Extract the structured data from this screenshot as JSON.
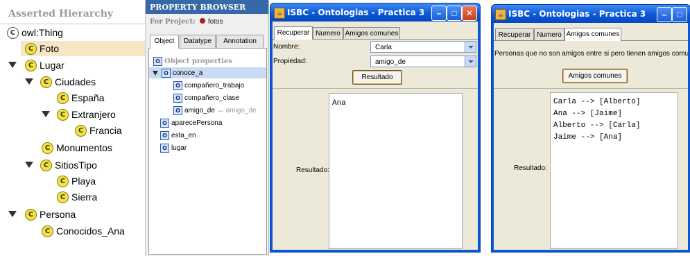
{
  "hierarchy": {
    "title": "Asserted Hierarchy",
    "icon_letter": "C",
    "nodes": [
      {
        "label": "owl:Thing"
      },
      {
        "label": "Foto"
      },
      {
        "label": "Lugar"
      },
      {
        "label": "Ciudades"
      },
      {
        "label": "España"
      },
      {
        "label": "Extranjero"
      },
      {
        "label": "Francia"
      },
      {
        "label": "Monumentos"
      },
      {
        "label": "SitiosTipo"
      },
      {
        "label": "Playa"
      },
      {
        "label": "Sierra"
      },
      {
        "label": "Persona"
      },
      {
        "label": "Conocidos_Ana"
      }
    ]
  },
  "property_browser": {
    "title": "PROPERTY BROWSER",
    "for_project_label": "For Project:",
    "project_name": "fotos",
    "tabs": [
      "Object",
      "Datatype",
      "Annotation"
    ],
    "section_header": "Object properties",
    "icon_letter": "O",
    "items": [
      {
        "label": "conoce_a"
      },
      {
        "label": "compañero_trabajo"
      },
      {
        "label": "compañero_clase"
      },
      {
        "label": "amigo_de",
        "inverse": "↔ amigo_de"
      },
      {
        "label": "aparecePersona"
      },
      {
        "label": "esta_en"
      },
      {
        "label": "lugar"
      }
    ]
  },
  "window1": {
    "title": "ISBC - Ontologias - Practica 3",
    "tabs": [
      "Recuperar",
      "Numero",
      "Amigos comunes"
    ],
    "nombre_label": "Nombre:",
    "nombre_value": "Carla",
    "propiedad_label": "Propiedad:",
    "propiedad_value": "amigo_de",
    "button": "Resultado",
    "resultado_label": "Resultado:",
    "output": "Ana"
  },
  "window2": {
    "title": "ISBC - Ontologias - Practica 3",
    "tabs": [
      "Recuperar",
      "Numero",
      "Amigos comunes"
    ],
    "description": "Personas que no son amigos entre si pero tienen amigos comunes",
    "button": "Amigos comunes",
    "resultado_label": "Resultado:",
    "output_lines": [
      "Carla --> [Alberto]",
      "Ana --> [Jaime]",
      "Alberto --> [Carla]",
      "Jaime --> [Ana]"
    ]
  },
  "colors": {
    "selection_class": "#f6e6c6",
    "selection_property": "#c8dbf2",
    "xp_titlebar": "#0a58d6",
    "property_browser_header": "#3768a8"
  }
}
